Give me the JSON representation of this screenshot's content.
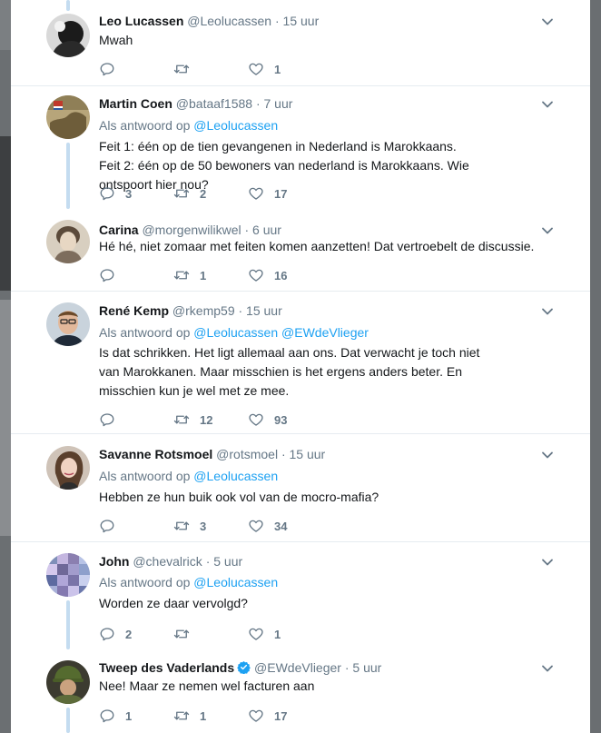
{
  "colors": {
    "link": "#1da1f2",
    "secondary": "#657786",
    "text": "#14171a",
    "thread": "#c4dcf0",
    "verified": "#1da1f2"
  },
  "tweets": [
    {
      "name": "Leo Lucassen",
      "handle": "@Leolucassen",
      "time": "· 15 uur",
      "text": "Mwah",
      "replies": "",
      "retweets": "",
      "likes": "1"
    },
    {
      "name": "Martin Coen",
      "handle": "@bataaf1588",
      "time": "· 7 uur",
      "reply_prefix": "Als antwoord op",
      "reply_to": "@Leolucassen",
      "text": "Feit 1: één op de tien gevangenen in Nederland is Marokkaans. Feit 2: één op de 50 bewoners van nederland is Marokkaans. Wie ontspoort hier nou?",
      "replies": "3",
      "retweets": "2",
      "likes": "17"
    },
    {
      "name": "Carina",
      "handle": "@morgenwilikwel",
      "time": "· 6 uur",
      "text": "Hé hé, niet zomaar met feiten komen aanzetten! Dat vertroebelt de discussie.",
      "replies": "",
      "retweets": "1",
      "likes": "16"
    },
    {
      "name": "René Kemp",
      "handle": "@rkemp59",
      "time": "· 15 uur",
      "reply_prefix": "Als antwoord op",
      "reply_to": "@Leolucassen",
      "reply_to_2": "@EWdeVlieger",
      "text": "Is dat schrikken. Het ligt allemaal aan ons. Dat verwacht je toch niet van Marokkanen. Maar misschien is het ergens anders beter. En misschien kun je wel met ze mee.",
      "replies": "",
      "retweets": "12",
      "likes": "93"
    },
    {
      "name": "Savanne Rotsmoel",
      "handle": "@rotsmoel",
      "time": "· 15 uur",
      "reply_prefix": "Als antwoord op",
      "reply_to": "@Leolucassen",
      "text": "Hebben ze hun buik ook vol van de mocro-mafia?",
      "replies": "",
      "retweets": "3",
      "likes": "34"
    },
    {
      "name": "John",
      "handle": "@chevalrick",
      "time": "· 5 uur",
      "reply_prefix": "Als antwoord op",
      "reply_to": "@Leolucassen",
      "text": "Worden ze daar vervolgd?",
      "replies": "2",
      "retweets": "",
      "likes": "1"
    },
    {
      "name": "Tweep des Vaderlands",
      "handle": "@EWdeVlieger",
      "time": "· 5 uur",
      "text": "Nee! Maar ze nemen wel facturen aan",
      "replies": "1",
      "retweets": "1",
      "likes": "17",
      "verified": true
    }
  ],
  "icons": {
    "reply": "reply-icon",
    "retweet": "retweet-icon",
    "like": "heart-icon",
    "more": "chevron-down-icon",
    "verified": "verified-badge-icon"
  }
}
